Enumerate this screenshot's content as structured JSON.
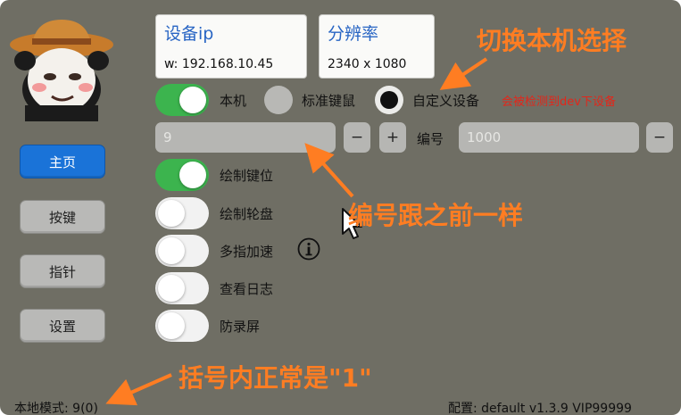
{
  "sidebar": {
    "items": [
      {
        "label": "主页",
        "active": true
      },
      {
        "label": "按键",
        "active": false
      },
      {
        "label": "指针",
        "active": false
      },
      {
        "label": "设置",
        "active": false
      }
    ]
  },
  "device_card": {
    "title": "设备ip",
    "value": "w: 192.168.10.45"
  },
  "resolution_card": {
    "title": "分辨率",
    "value": "2340 x 1080"
  },
  "device_mode": {
    "local_toggle_on": true,
    "local_label": "本机",
    "standard_label": "标准键鼠",
    "custom_label": "自定义设备",
    "selected": "自定义设备",
    "warning": "会被检测到dev下设备"
  },
  "id_row": {
    "input_value": "9",
    "minus_label": "−",
    "plus_label": "+",
    "id_label": "编号",
    "id_value": "1000",
    "id_minus_label": "−"
  },
  "options": [
    {
      "label": "绘制键位",
      "on": true
    },
    {
      "label": "绘制轮盘",
      "on": false
    },
    {
      "label": "多指加速",
      "on": false
    },
    {
      "label": "查看日志",
      "on": false
    },
    {
      "label": "防录屏",
      "on": false
    }
  ],
  "status": {
    "left": "本地模式: 9(0)",
    "right": "配置: default v1.3.9   VIP99999"
  },
  "annotations": {
    "switch_local": "切换本机选择",
    "id_same": "编号跟之前一样",
    "bracket_normal": "括号内正常是\"1\""
  },
  "colors": {
    "window_bg": "#6f6e64",
    "toggle_on": "#3cb44e",
    "accent_blue": "#1a73d8",
    "annotation": "#ff7d22",
    "warning": "#e3261a"
  },
  "icons": {
    "info": "info-icon",
    "cursor": "mouse-cursor-icon",
    "avatar": "panda-meme-avatar"
  }
}
